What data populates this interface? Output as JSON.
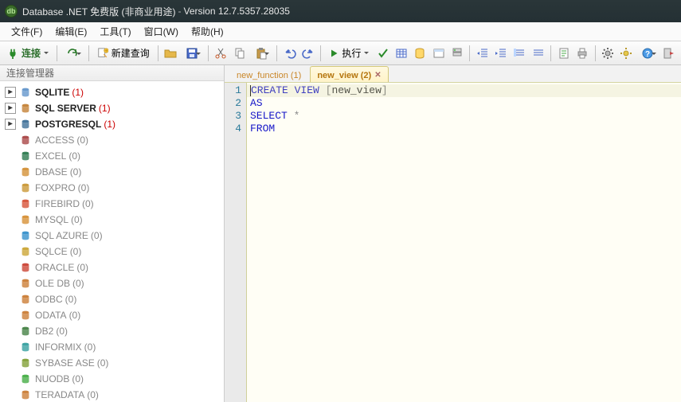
{
  "titlebar": {
    "app": "Database .NET 免费版 (非商业用途)",
    "sep": "-",
    "version": "Version 12.7.5357.28035"
  },
  "menu": {
    "file": "文件(F)",
    "edit": "编辑(E)",
    "tools": "工具(T)",
    "window": "窗口(W)",
    "help": "帮助(H)"
  },
  "toolbar": {
    "connect": "连接",
    "newquery": "新建查询",
    "execute": "执行"
  },
  "sidebar": {
    "title": "连接管理器",
    "items": [
      {
        "label": "SQLITE",
        "count": "(1)",
        "bold": true,
        "twisty": "▸",
        "icon": "sqlite",
        "red": true
      },
      {
        "label": "SQL SERVER",
        "count": "(1)",
        "bold": true,
        "twisty": "▸",
        "icon": "sqlserver",
        "red": true
      },
      {
        "label": "POSTGRESQL",
        "count": "(1)",
        "bold": true,
        "twisty": "▸",
        "icon": "postgres",
        "red": true
      },
      {
        "label": "ACCESS",
        "count": "(0)",
        "icon": "access"
      },
      {
        "label": "EXCEL",
        "count": "(0)",
        "icon": "excel"
      },
      {
        "label": "DBASE",
        "count": "(0)",
        "icon": "dbase"
      },
      {
        "label": "FOXPRO",
        "count": "(0)",
        "icon": "foxpro"
      },
      {
        "label": "FIREBIRD",
        "count": "(0)",
        "icon": "firebird"
      },
      {
        "label": "MYSQL",
        "count": "(0)",
        "icon": "mysql"
      },
      {
        "label": "SQL AZURE",
        "count": "(0)",
        "icon": "sqlazure"
      },
      {
        "label": "SQLCE",
        "count": "(0)",
        "icon": "sqlce"
      },
      {
        "label": "ORACLE",
        "count": "(0)",
        "icon": "oracle"
      },
      {
        "label": "OLE DB",
        "count": "(0)",
        "icon": "oledb"
      },
      {
        "label": "ODBC",
        "count": "(0)",
        "icon": "odbc"
      },
      {
        "label": "ODATA",
        "count": "(0)",
        "icon": "odata"
      },
      {
        "label": "DB2",
        "count": "(0)",
        "icon": "db2"
      },
      {
        "label": "INFORMIX",
        "count": "(0)",
        "icon": "informix"
      },
      {
        "label": "SYBASE ASE",
        "count": "(0)",
        "icon": "sybase"
      },
      {
        "label": "NUODB",
        "count": "(0)",
        "icon": "nuodb"
      },
      {
        "label": "TERADATA",
        "count": "(0)",
        "icon": "teradata"
      }
    ]
  },
  "tabs": {
    "list": [
      {
        "label": "new_function (1)",
        "active": false
      },
      {
        "label": "new_view (2)",
        "active": true
      }
    ]
  },
  "editor": {
    "gutter": [
      "1",
      "2",
      "3",
      "4"
    ],
    "tokens": {
      "l1_kw1": "CREATE",
      "l1_kw2": "VIEW",
      "l1_lb": "[",
      "l1_id": "new_view",
      "l1_rb": "]",
      "l2_kw": "AS",
      "l3_kw": "SELECT",
      "l3_star": "*",
      "l4_kw": "FROM"
    }
  },
  "iconColors": {
    "sqlite": "#5a8fc8",
    "sqlserver": "#c07a2a",
    "postgres": "#336791",
    "access": "#a43b3b",
    "excel": "#1f7244",
    "dbase": "#d08a2a",
    "foxpro": "#c7912a",
    "firebird": "#d4472b",
    "mysql": "#d48a2a",
    "sqlazure": "#2a8ac8",
    "sqlce": "#c8a02a",
    "oracle": "#c8392a",
    "oledb": "#c8762a",
    "odbc": "#c8762a",
    "odata": "#c8762a",
    "db2": "#3a7a3a",
    "informix": "#2a9a9a",
    "sybase": "#7a9a2a",
    "nuodb": "#3aa83a",
    "teradata": "#c8762a"
  }
}
